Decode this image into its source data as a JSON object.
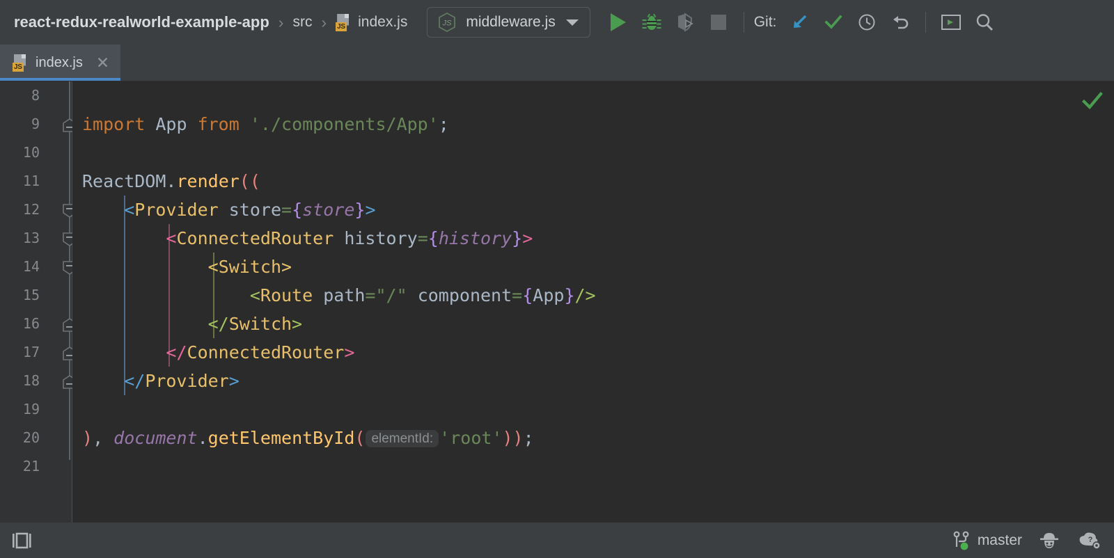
{
  "breadcrumb": {
    "project": "react-redux-realworld-example-app",
    "separator": "›",
    "folder": "src",
    "file": "index.js",
    "file_icon": "js-file-icon"
  },
  "toolbar": {
    "run_config": {
      "name": "middleware.js",
      "icon": "nodejs-js-icon",
      "dropdown_icon": "chevron-down-icon"
    },
    "buttons": [
      {
        "name": "run-button",
        "icon": "run-triangle-icon"
      },
      {
        "name": "debug-button",
        "icon": "bug-icon"
      },
      {
        "name": "coverage-button",
        "icon": "run-with-coverage-icon"
      },
      {
        "name": "stop-button",
        "icon": "stop-square-icon"
      }
    ],
    "git_label": "Git:",
    "git_buttons": [
      {
        "name": "update-project-button",
        "icon": "arrow-down-left-icon"
      },
      {
        "name": "commit-button",
        "icon": "checkmark-icon"
      },
      {
        "name": "history-button",
        "icon": "clock-icon"
      },
      {
        "name": "rollback-button",
        "icon": "undo-arrow-icon"
      }
    ],
    "right_buttons": [
      {
        "name": "terminal-button",
        "icon": "terminal-window-icon"
      },
      {
        "name": "search-everywhere-button",
        "icon": "search-icon"
      }
    ]
  },
  "tabs": [
    {
      "label": "index.js",
      "icon": "js-file-icon",
      "close_icon": "close-icon",
      "active": true
    }
  ],
  "editor": {
    "inspection_status_icon": "green-checkmark-icon",
    "first_line_number": 8,
    "lines": [
      {
        "num": 8,
        "fold": "none"
      },
      {
        "num": 9,
        "fold": "end-up"
      },
      {
        "num": 10,
        "fold": "none"
      },
      {
        "num": 11,
        "fold": "none"
      },
      {
        "num": 12,
        "fold": "start-down"
      },
      {
        "num": 13,
        "fold": "start-down"
      },
      {
        "num": 14,
        "fold": "start-down"
      },
      {
        "num": 15,
        "fold": "none"
      },
      {
        "num": 16,
        "fold": "end-up"
      },
      {
        "num": 17,
        "fold": "end-up"
      },
      {
        "num": 18,
        "fold": "end-up"
      },
      {
        "num": 19,
        "fold": "none"
      },
      {
        "num": 20,
        "fold": "none"
      },
      {
        "num": 21,
        "fold": "none"
      }
    ],
    "code_text": {
      "l9": "import App from './components/App';",
      "l11": "ReactDOM.render((",
      "l12": "<Provider store={store}>",
      "l13": "<ConnectedRouter history={history}>",
      "l14": "<Switch>",
      "l15": "<Route path=\"/\" component={App}/>",
      "l16": "</Switch>",
      "l17": "</ConnectedRouter>",
      "l18": "</Provider>",
      "l20": "), document.getElementById( elementId: 'root'));",
      "inlay_hint": "elementId:"
    }
  },
  "statusbar": {
    "layout_icon": "tool-windows-layout-icon",
    "branch": "master",
    "branch_icon": "git-branch-icon",
    "inspector_icon": "detective-hat-icon",
    "help_icon": "help-settings-icon"
  },
  "colors": {
    "accent_blue": "#4a88c7",
    "run_green": "#4a9c51",
    "editor_bg": "#2b2b2b",
    "gutter_bg": "#313335",
    "chrome_bg": "#3c3f41",
    "tab_active_bg": "#4a4f55",
    "js_badge": "#d8a33a"
  }
}
